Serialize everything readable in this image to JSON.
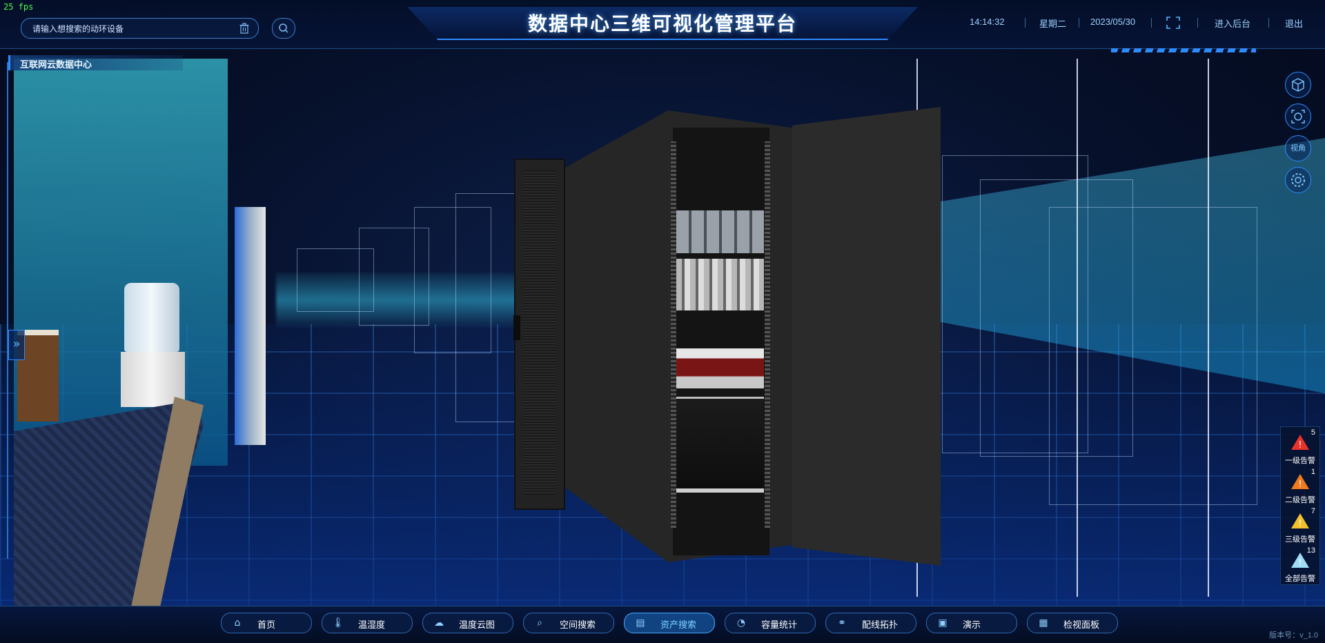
{
  "fps": "25 fps",
  "title": "数据中心三维可视化管理平台",
  "search": {
    "placeholder": "请输入想搜索的动环设备"
  },
  "header": {
    "time": "14:14:32",
    "weekday": "星期二",
    "date": "2023/05/30",
    "admin_label": "进入后台",
    "logout_label": "退出"
  },
  "panel": {
    "title": "互联网云数据中心"
  },
  "tools": [
    {
      "icon": "cube-3d-icon",
      "label": ""
    },
    {
      "icon": "capture-icon",
      "label": ""
    },
    {
      "icon": "view-angle-icon",
      "label": "视角"
    },
    {
      "icon": "gear-icon",
      "label": ""
    }
  ],
  "alerts": [
    {
      "label": "一级告警",
      "count": "5",
      "color": "#e8322a"
    },
    {
      "label": "二级告警",
      "count": "1",
      "color": "#f07a1e"
    },
    {
      "label": "三级告警",
      "count": "7",
      "color": "#f2c02a"
    },
    {
      "label": "全部告警",
      "count": "13",
      "color": "#9fdcf5"
    }
  ],
  "nav": [
    {
      "label": "首页",
      "icon": "home-icon",
      "active": false
    },
    {
      "label": "温湿度",
      "icon": "thermometer-icon",
      "active": false
    },
    {
      "label": "温度云图",
      "icon": "cloud-icon",
      "active": false
    },
    {
      "label": "空间搜索",
      "icon": "space-search-icon",
      "active": false
    },
    {
      "label": "资产搜索",
      "icon": "asset-search-icon",
      "active": true
    },
    {
      "label": "容量统计",
      "icon": "pie-chart-icon",
      "active": false
    },
    {
      "label": "配线拓扑",
      "icon": "topology-icon",
      "active": false
    },
    {
      "label": "演示",
      "icon": "presentation-icon",
      "active": false
    },
    {
      "label": "检视面板",
      "icon": "dashboard-icon",
      "active": false
    }
  ],
  "version": "版本号：v_1.0",
  "colors": {
    "accent": "#2e8cff",
    "title_glow": "#64b4ff",
    "bar_bg": "#06143a"
  }
}
